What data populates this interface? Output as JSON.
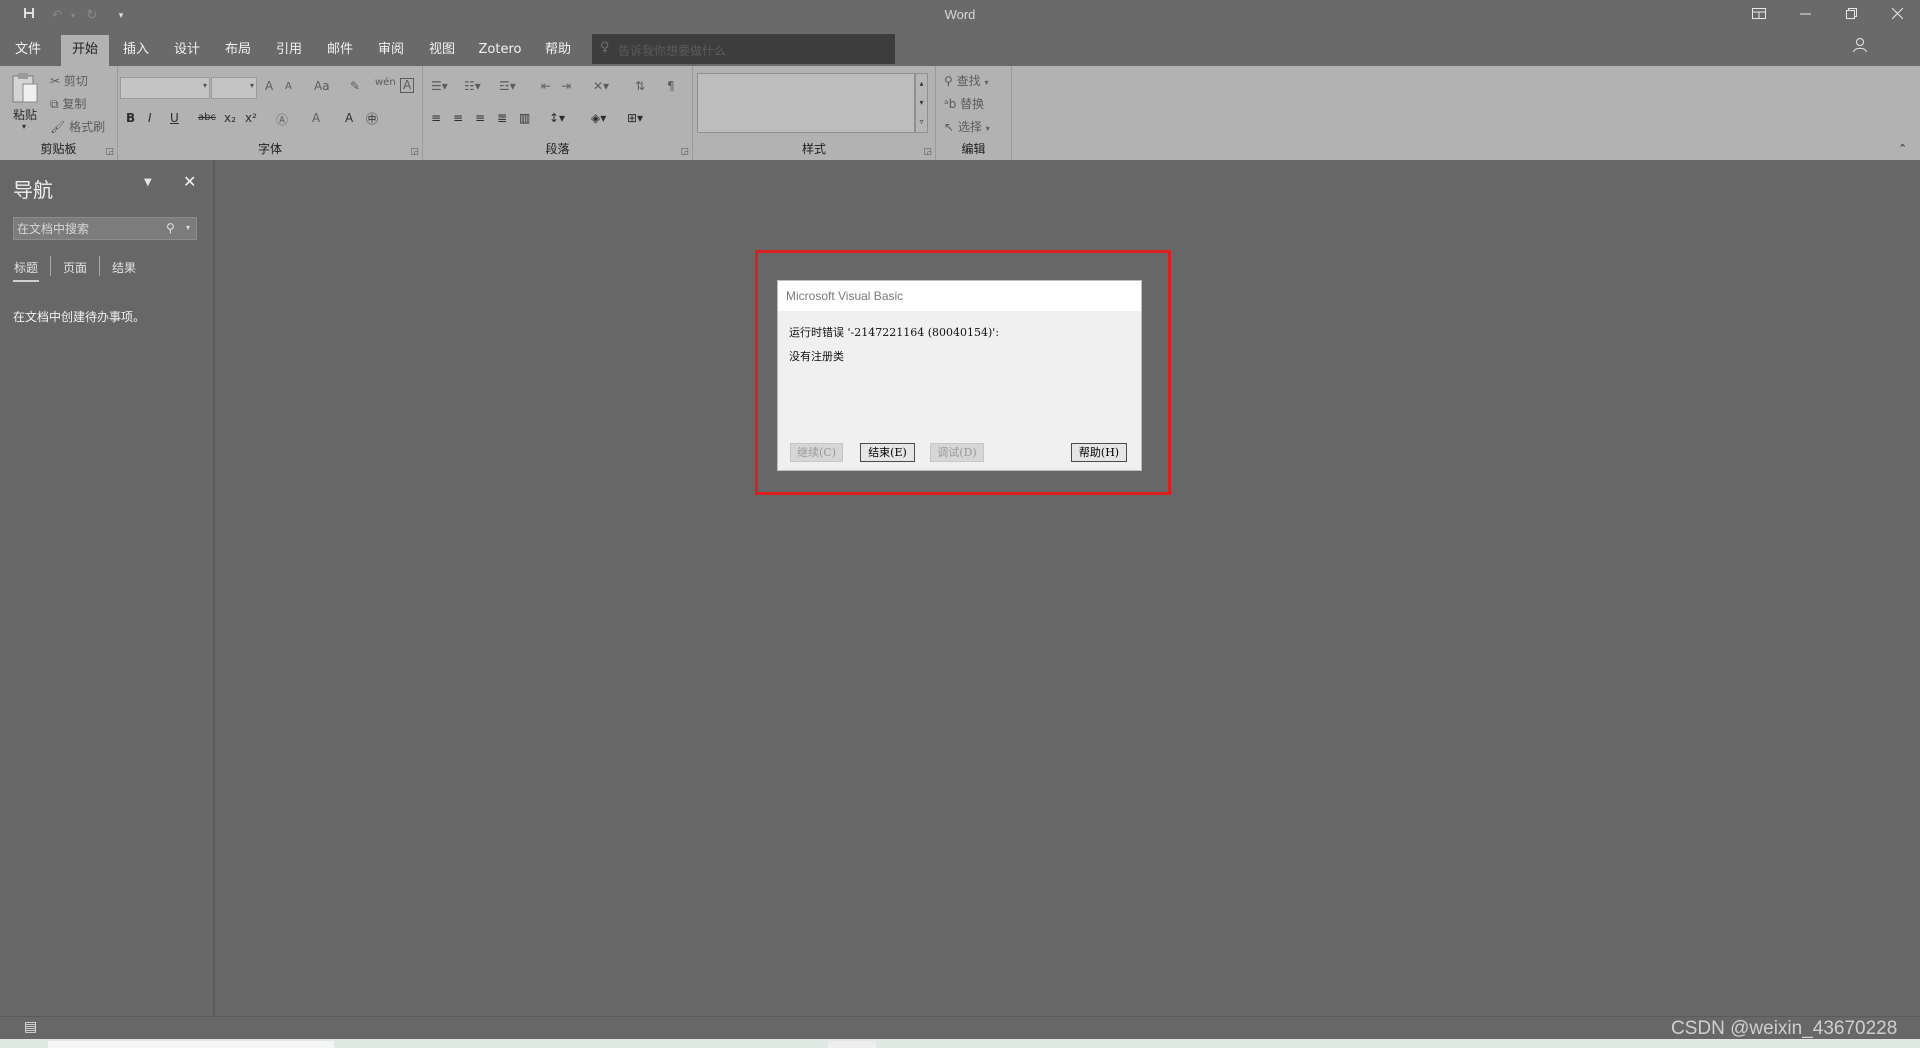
{
  "app": {
    "title": "Word",
    "quick_access": {
      "save_icon": "save-icon",
      "undo_icon": "undo-icon",
      "redo_icon": "redo-icon",
      "customize_icon": "customize-icon"
    },
    "window_controls": {
      "ribbon_display_icon": "ribbon-display-icon",
      "minimize_icon": "minimize-icon",
      "restore_icon": "restore-icon",
      "close_icon": "close-icon"
    }
  },
  "tabs": [
    "文件",
    "开始",
    "插入",
    "设计",
    "布局",
    "引用",
    "邮件",
    "审阅",
    "视图",
    "Zotero",
    "帮助"
  ],
  "active_tab": "开始",
  "tell_me": {
    "placeholder": "告诉我你想要做什么"
  },
  "ribbon": {
    "clipboard": {
      "label": "剪贴板",
      "paste": "粘贴",
      "cut": "剪切",
      "copy": "复制",
      "format_painter": "格式刷"
    },
    "font": {
      "label": "字体",
      "bold": "B",
      "italic": "I",
      "underline": "U",
      "strikethrough": "abc",
      "subscript": "x₂",
      "superscript": "x²",
      "grow": "A",
      "shrink": "A",
      "change_case": "Aa",
      "font_color": "A",
      "highlight": "A"
    },
    "paragraph": {
      "label": "段落"
    },
    "styles": {
      "label": "样式"
    },
    "editing": {
      "label": "编辑",
      "find": "查找",
      "replace": "替换",
      "select": "选择"
    }
  },
  "nav_pane": {
    "title": "导航",
    "search_placeholder": "在文档中搜索",
    "tabs": [
      "标题",
      "页面",
      "结果"
    ],
    "message": "在文档中创建待办事项。"
  },
  "dialog": {
    "title": "Microsoft Visual Basic",
    "line1": "运行时错误 '-2147221164 (80040154)':",
    "line2": "没有注册类",
    "buttons": {
      "continue": "继续(C)",
      "end": "结束(E)",
      "debug": "调试(D)",
      "help": "帮助(H)"
    }
  },
  "watermark": "CSDN @weixin_43670228",
  "colors": {
    "highlight": "#d92020",
    "ribbon_bg": "#b2b2b2",
    "app_bg": "#676767"
  }
}
